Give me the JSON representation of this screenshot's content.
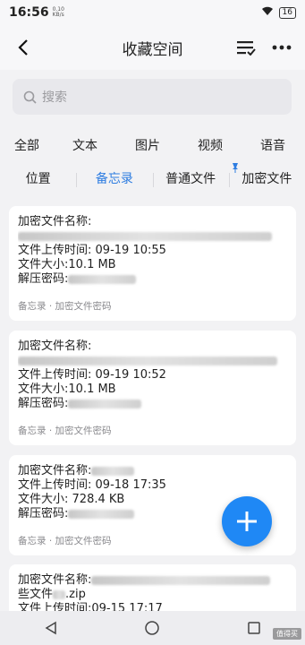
{
  "status_bar": {
    "time": "16:56",
    "speed_value": "0.10",
    "speed_unit": "KB/s",
    "battery": "16"
  },
  "header": {
    "title": "收藏空间"
  },
  "search": {
    "placeholder": "搜索"
  },
  "categories_row1": [
    "全部",
    "文本",
    "图片",
    "视频",
    "语音"
  ],
  "categories_row2": [
    {
      "label": "位置",
      "active": false
    },
    {
      "label": "备忘录",
      "active": true
    },
    {
      "label": "普通文件",
      "active": false
    },
    {
      "label": "加密文件",
      "active": false
    }
  ],
  "cards": [
    {
      "name_label": "加密文件名称:",
      "upload_time_label": "文件上传时间:",
      "upload_time": "09-19 10:55",
      "size_label": "文件大小:",
      "size": "10.1 MB",
      "password_label": "解压密码:",
      "footer": "备忘录 · 加密文件密码"
    },
    {
      "name_label": "加密文件名称:",
      "upload_time_label": "文件上传时间:",
      "upload_time": "09-19 10:52",
      "size_label": "文件大小:",
      "size": "10.1 MB",
      "password_label": "解压密码:",
      "footer": "备忘录 · 加密文件密码"
    },
    {
      "name_label": "加密文件名称:",
      "upload_time_label": "文件上传时间:",
      "upload_time": "09-18 17:35",
      "size_label": "文件大小:",
      "size": "728.4 KB",
      "password_label": "解压密码:",
      "footer": "备忘录 · 加密文件密码"
    },
    {
      "name_label": "加密文件名称:",
      "name_line2": "些文件",
      "name_ext": ".zip",
      "upload_time_label": "文件上传时间:",
      "upload_time": "09-15 17:17"
    }
  ],
  "watermark": "值得买"
}
